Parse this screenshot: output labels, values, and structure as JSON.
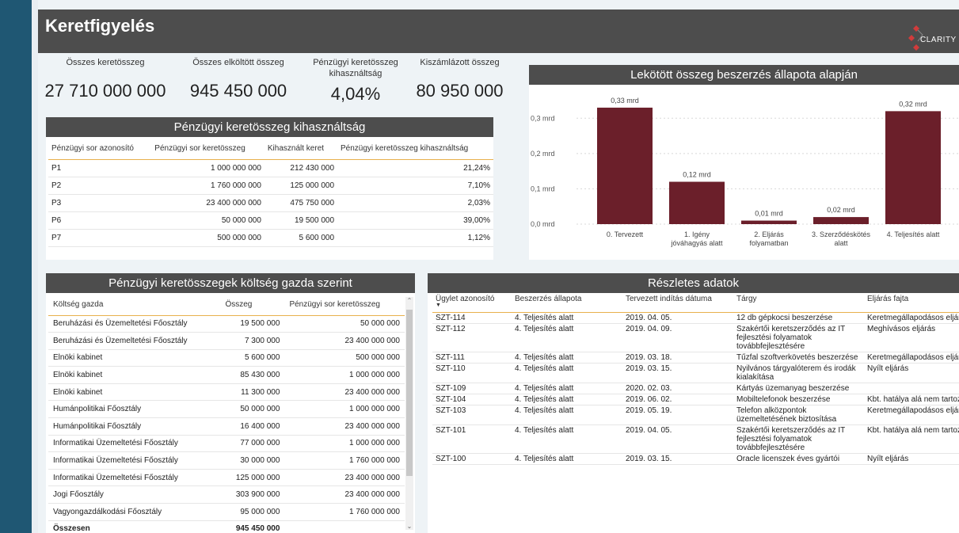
{
  "header": {
    "title": "Keretfigyelés",
    "logo_text": "CLARITY"
  },
  "kpis": [
    {
      "label": "Összes keretösszeg",
      "value": "27 710 000 000"
    },
    {
      "label": "Összes elköltött összeg",
      "value": "945 450 000"
    },
    {
      "label": "Pénzügyi keretösszeg kihasználtság",
      "value": "4,04%"
    },
    {
      "label": "Kiszámlázott összeg",
      "value": "80 950 000"
    }
  ],
  "utilization": {
    "title": "Pénzügyi keretösszeg kihasználtság",
    "columns": [
      "Pénzügyi sor azonosító",
      "Pénzügyi sor keretösszeg",
      "Kihasznált keret",
      "Pénzügyi keretösszeg kihasználtság"
    ],
    "rows": [
      [
        "P1",
        "1 000 000 000",
        "212 430 000",
        "21,24%"
      ],
      [
        "P2",
        "1 760 000 000",
        "125 000 000",
        "7,10%"
      ],
      [
        "P3",
        "23 400 000 000",
        "475 750 000",
        "2,03%"
      ],
      [
        "P6",
        "50 000 000",
        "19 500 000",
        "39,00%"
      ],
      [
        "P7",
        "500 000 000",
        "5 600 000",
        "1,12%"
      ]
    ]
  },
  "chart": {
    "title": "Lekötött összeg beszerzés állapota alapján",
    "bar_color": "#6b1f2a"
  },
  "chart_data": {
    "type": "bar",
    "title": "Lekötött összeg beszerzés állapota alapján",
    "categories": [
      "0. Tervezett",
      "1. Igény jóváhagyás alatt",
      "2. Eljárás folyamatban",
      "3. Szerződéskötés alatt",
      "4. Teljesítés alatt"
    ],
    "values": [
      0.33,
      0.12,
      0.01,
      0.02,
      0.32
    ],
    "data_labels": [
      "0,33 mrd",
      "0,12 mrd",
      "0,01 mrd",
      "0,02 mrd",
      "0,32 mrd"
    ],
    "y_ticks": [
      "0,0 mrd",
      "0,1 mrd",
      "0,2 mrd",
      "0,3 mrd"
    ],
    "ylim": [
      0,
      0.35
    ],
    "grid": true
  },
  "owners": {
    "title": "Pénzügyi keretösszegek költség gazda szerint",
    "columns": [
      "Költség gazda",
      "Összeg",
      "Pénzügyi sor keretösszeg"
    ],
    "rows": [
      [
        "Beruházási és Üzemeltetési Főosztály",
        "19 500 000",
        "50 000 000"
      ],
      [
        "Beruházási és Üzemeltetési Főosztály",
        "7 300 000",
        "23 400 000 000"
      ],
      [
        "Elnöki kabinet",
        "5 600 000",
        "500 000 000"
      ],
      [
        "Elnöki kabinet",
        "85 430 000",
        "1 000 000 000"
      ],
      [
        "Elnöki kabinet",
        "11 300 000",
        "23 400 000 000"
      ],
      [
        "Humánpolitikai Főosztály",
        "50 000 000",
        "1 000 000 000"
      ],
      [
        "Humánpolitikai Főosztály",
        "16 400 000",
        "23 400 000 000"
      ],
      [
        "Informatikai Üzemeltetési Főosztály",
        "77 000 000",
        "1 000 000 000"
      ],
      [
        "Informatikai Üzemeltetési Főosztály",
        "30 000 000",
        "1 760 000 000"
      ],
      [
        "Informatikai Üzemeltetési Főosztály",
        "125 000 000",
        "23 400 000 000"
      ],
      [
        "Jogi Főosztály",
        "303 900 000",
        "23 400 000 000"
      ],
      [
        "Vagyongazdálkodási Főosztály",
        "95 000 000",
        "1 760 000 000"
      ]
    ],
    "total_label": "Összesen",
    "total_value": "945 450 000"
  },
  "details": {
    "title": "Részletes adatok",
    "columns": [
      "Ügylet azonosító",
      "Beszerzés állapota",
      "Tervezett indítás dátuma",
      "Tárgy",
      "Eljárás fajta"
    ],
    "rows": [
      [
        "SZT-114",
        "4. Teljesítés alatt",
        "2019. 04. 05.",
        "12 db gépkocsi beszerzése",
        "Keretmegállapodásos eljárás"
      ],
      [
        "SZT-112",
        "4. Teljesítés alatt",
        "2019. 04. 09.",
        "Szakértői keretszerződés az IT fejlesztési folyamatok továbbfejlesztésére",
        "Meghívásos eljárás"
      ],
      [
        "SZT-111",
        "4. Teljesítés alatt",
        "2019. 03. 18.",
        "Tűzfal szoftverkövetés beszerzése",
        "Keretmegállapodásos eljárás"
      ],
      [
        "SZT-110",
        "4. Teljesítés alatt",
        "2019. 03. 15.",
        "Nyilvános tárgyalóterem és irodák kialakítása",
        "Nyílt eljárás"
      ],
      [
        "SZT-109",
        "4. Teljesítés alatt",
        "2020. 02. 03.",
        "Kártyás üzemanyag beszerzése",
        ""
      ],
      [
        "SZT-104",
        "4. Teljesítés alatt",
        "2019. 06. 02.",
        "Mobiltelefonok beszerzése",
        "Kbt. hatálya alá nem tartozó"
      ],
      [
        "SZT-103",
        "4. Teljesítés alatt",
        "2019. 05. 19.",
        "Telefon alközpontok üzemeltetésének biztosítása",
        "Keretmegállapodásos eljárás"
      ],
      [
        "SZT-101",
        "4. Teljesítés alatt",
        "2019. 04. 05.",
        "Szakértői keretszerződés az IT fejlesztési folyamatok továbbfejlesztésére",
        "Kbt. hatálya alá nem tartozó"
      ],
      [
        "SZT-100",
        "4. Teljesítés alatt",
        "2019. 03. 15.",
        "Oracle licenszek éves gyártói",
        "Nyílt eljárás"
      ]
    ]
  }
}
